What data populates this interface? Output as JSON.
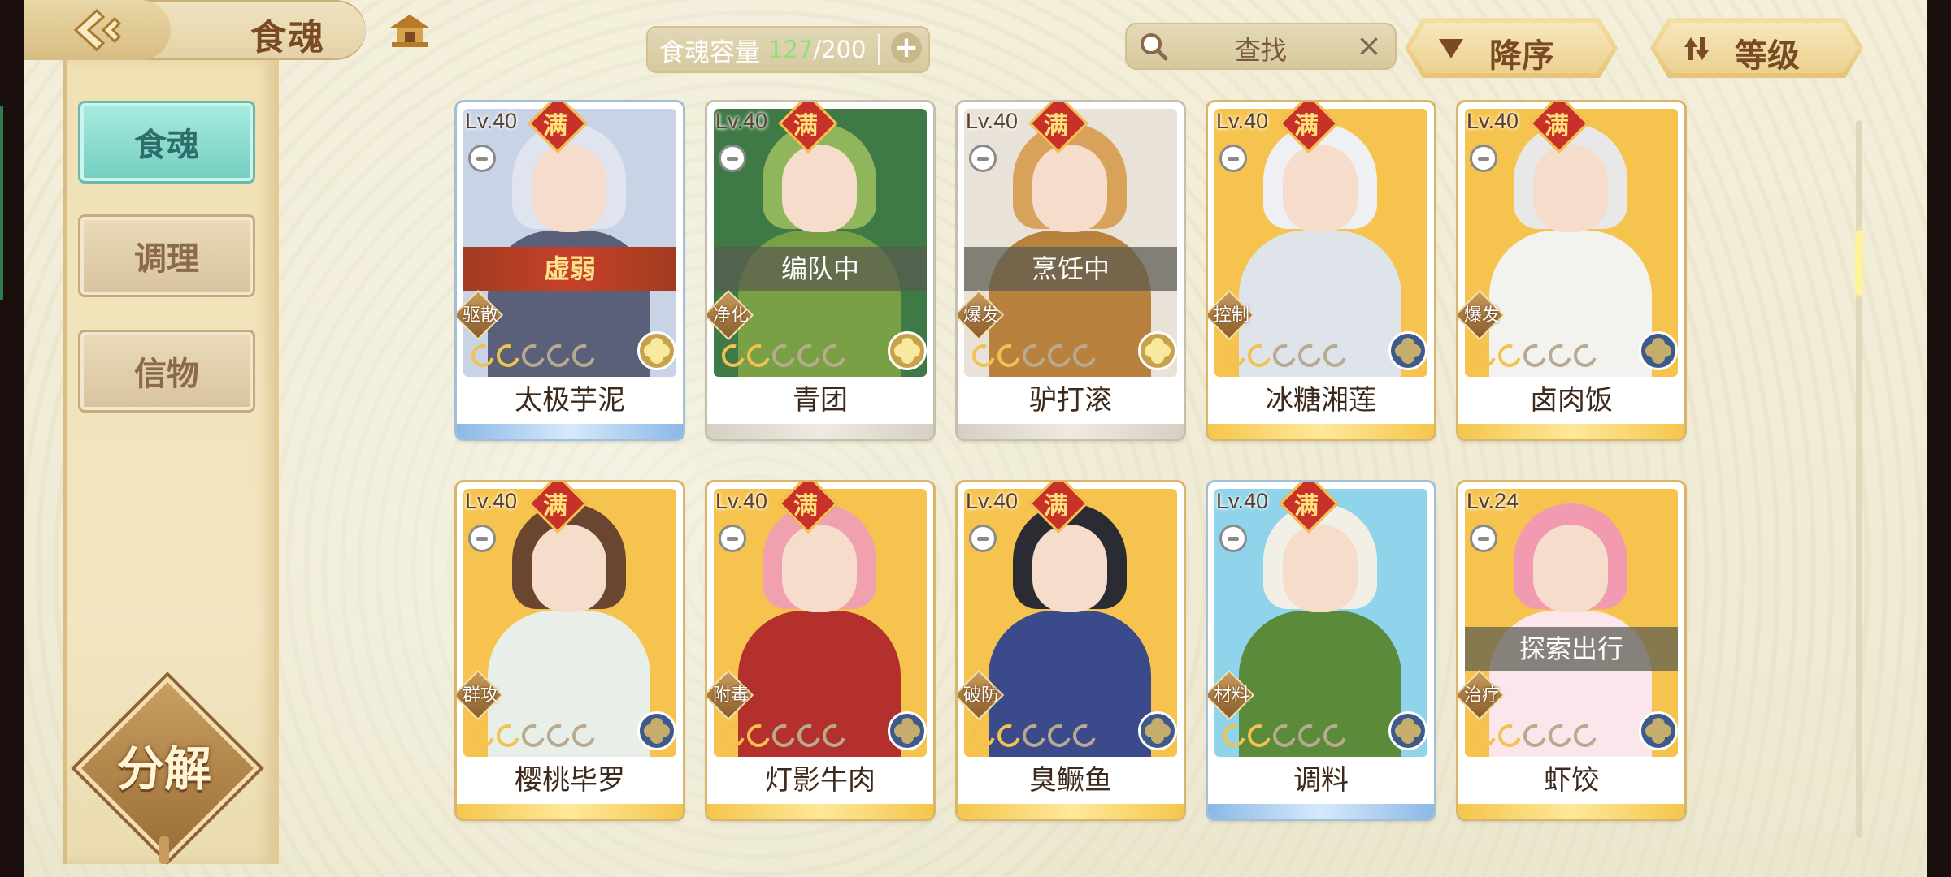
{
  "header": {
    "title": "食魂",
    "capacity": {
      "label": "食魂容量",
      "current": "127",
      "separator": "/",
      "max": "200",
      "plus": "+"
    },
    "search": {
      "text": "查找",
      "clear": "×"
    },
    "sort_order": {
      "label": "降序",
      "icon": "triangle-down-icon"
    },
    "sort_by": {
      "label": "等级",
      "icon": "sort-arrows-icon"
    }
  },
  "sidebar": {
    "tabs": [
      {
        "label": "食魂",
        "active": true
      },
      {
        "label": "调理",
        "active": false
      },
      {
        "label": "信物",
        "active": false
      }
    ],
    "decompose_label": "分解"
  },
  "colors": {
    "gold_frame": "#d9b56a",
    "blue_frame": "#a3bfd8",
    "capacity_current": "#8fe07a",
    "active_tab": "#73cdc0"
  },
  "cards": [
    {
      "level": "Lv.40",
      "full": "满",
      "role": "驱散",
      "name": "太极芋泥",
      "status": "虚弱",
      "status_style": "red",
      "stars_on": 2,
      "stars_total": 5,
      "element": "gold",
      "frame": "blue",
      "bg": "#c9d3e6",
      "hair": "#dfe4ee",
      "body": "#5a5f7a"
    },
    {
      "level": "Lv.40",
      "full": "满",
      "role": "净化",
      "name": "青团",
      "status": "编队中",
      "status_style": "gray",
      "stars_on": 2,
      "stars_total": 5,
      "element": "gold",
      "frame": "gray",
      "bg": "#3f7a46",
      "hair": "#8fb65a",
      "body": "#7aa046"
    },
    {
      "level": "Lv.40",
      "full": "满",
      "role": "爆发",
      "name": "驴打滚",
      "status": "烹饪中",
      "status_style": "gray",
      "stars_on": 2,
      "stars_total": 5,
      "element": "gold",
      "frame": "gray",
      "bg": "#e9e2d8",
      "hair": "#d9a25a",
      "body": "#b8823e"
    },
    {
      "level": "Lv.40",
      "full": "满",
      "role": "控制",
      "name": "冰糖湘莲",
      "status": "",
      "status_style": "none",
      "stars_on": 2,
      "stars_total": 5,
      "element": "blue",
      "frame": "gold",
      "bg": "#f6c44e",
      "hair": "#eef0f4",
      "body": "#dfe3ea"
    },
    {
      "level": "Lv.40",
      "full": "满",
      "role": "爆发",
      "name": "卤肉饭",
      "status": "",
      "status_style": "none",
      "stars_on": 2,
      "stars_total": 5,
      "element": "blue",
      "frame": "gold",
      "bg": "#f6c44e",
      "hair": "#e8e8e8",
      "body": "#f2f2ee"
    },
    {
      "level": "Lv.40",
      "full": "满",
      "role": "群攻",
      "name": "樱桃毕罗",
      "status": "",
      "status_style": "none",
      "stars_on": 2,
      "stars_total": 5,
      "element": "blue",
      "frame": "gold",
      "bg": "#f6c44e",
      "hair": "#6a4530",
      "body": "#e8efe8"
    },
    {
      "level": "Lv.40",
      "full": "满",
      "role": "附毒",
      "name": "灯影牛肉",
      "status": "",
      "status_style": "none",
      "stars_on": 2,
      "stars_total": 5,
      "element": "blue",
      "frame": "gold",
      "bg": "#f6c44e",
      "hair": "#f0a0ae",
      "body": "#b3302c"
    },
    {
      "level": "Lv.40",
      "full": "满",
      "role": "破防",
      "name": "臭鳜鱼",
      "status": "",
      "status_style": "none",
      "stars_on": 2,
      "stars_total": 5,
      "element": "blue",
      "frame": "gold",
      "bg": "#f6c44e",
      "hair": "#2b2b33",
      "body": "#3a4a8a"
    },
    {
      "level": "Lv.40",
      "full": "满",
      "role": "材料",
      "name": "调料",
      "status": "",
      "status_style": "none",
      "stars_on": 2,
      "stars_total": 5,
      "element": "blue",
      "frame": "blue",
      "bg": "#8fd4ea",
      "hair": "#f2efe6",
      "body": "#5a8a3a"
    },
    {
      "level": "Lv.24",
      "full": "",
      "role": "治疗",
      "name": "虾饺",
      "status": "探索出行",
      "status_style": "gray",
      "stars_on": 2,
      "stars_total": 5,
      "element": "blue",
      "frame": "gold",
      "bg": "#f6c44e",
      "hair": "#f29ab0",
      "body": "#fbe6ec"
    }
  ]
}
